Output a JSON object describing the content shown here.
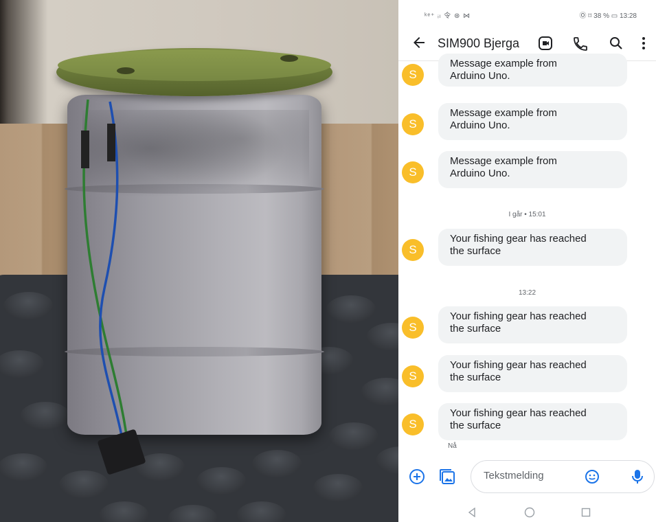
{
  "photo": {
    "description_icon": "buoy-device-photo"
  },
  "status_bar": {
    "left_text": "ᵏᵉ⁺ ᵢₗ 令 ⊛ ⋈",
    "right_text": "Ⓞ ⌑ 38 % ▭ 13:28"
  },
  "app_bar": {
    "back_icon": "back-arrow-icon",
    "title": "SIM900 Bjerga",
    "icons": [
      "video-call-icon",
      "phone-icon",
      "search-icon",
      "more-icon"
    ]
  },
  "avatar_letter": "S",
  "messages": [
    {
      "text_line1": "Message example from",
      "text_line2": "Arduino Uno."
    },
    {
      "text_line1": "Message example from",
      "text_line2": "Arduino Uno."
    },
    {
      "text_line1": "Message example from",
      "text_line2": "Arduino Uno."
    },
    {
      "text_line1": "Your fishing gear has reached",
      "text_line2": "the surface"
    },
    {
      "text_line1": "Your fishing gear has reached",
      "text_line2": "the surface"
    },
    {
      "text_line1": "Your fishing gear has reached",
      "text_line2": "the surface"
    },
    {
      "text_line1": "Your fishing gear has reached",
      "text_line2": "the surface"
    }
  ],
  "dividers": {
    "yesterday": "I går • 15:01",
    "today": "13:22"
  },
  "last_status": "Nå",
  "composer": {
    "placeholder": "Tekstmelding"
  },
  "colors": {
    "avatar": "#f9be2a",
    "accent": "#1a73e8",
    "bubble": "#f1f3f4"
  }
}
